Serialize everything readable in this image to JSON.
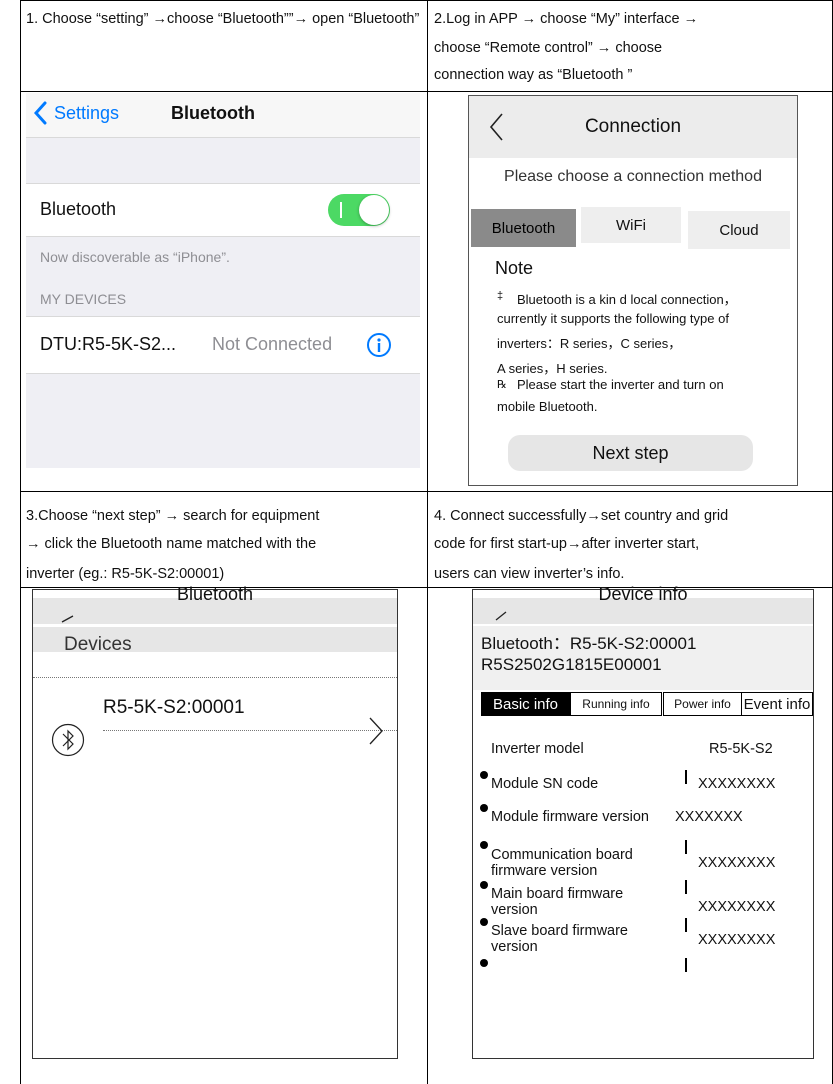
{
  "captions": {
    "step1": "1. Choose “setting” →choose “Bluetooth””→ open “Bluetooth”",
    "step2_line1": "2.Log in APP → choose “My” interface →",
    "step2_line2": "choose “Remote control” → choose",
    "step2_line3": "connection way as “Bluetooth ”",
    "step3_line1": "3.Choose “next step” → search for equipment",
    "step3_line2": "→ click the Bluetooth name matched with the",
    "step3_line3": "inverter (eg.: R5-5K-S2:00001)",
    "step4_line1": "4. Connect successfully→set country and grid",
    "step4_line2": "code for first start-up→after inverter start,",
    "step4_line3": "users can view inverter’s info."
  },
  "ios_settings": {
    "back_label": "Settings",
    "title": "Bluetooth",
    "bluetooth_label": "Bluetooth",
    "toggle_state": "on",
    "discoverable_text": "Now discoverable as “iPhone”.",
    "section_header": "MY DEVICES",
    "device_name": "DTU:R5-5K-S2...",
    "device_status": "Not Connected",
    "accent_color": "#007aff",
    "toggle_color": "#4cd964"
  },
  "connection_screen": {
    "title": "Connection",
    "prompt": "Please choose a connection method",
    "tabs": [
      {
        "label": "Bluetooth",
        "selected": true
      },
      {
        "label": "WiFi",
        "selected": false
      },
      {
        "label": "Cloud",
        "selected": false
      }
    ],
    "note_title": "Note",
    "note_bullet1": "‡",
    "note_line1": "Bluetooth is a kin d local connection，",
    "note_line2": "currently it supports the following type of",
    "note_line3": "inverters：R series，C series，",
    "note_line4": "A series，H series.",
    "note_bullet2": "℞",
    "note_line5": "Please start the inverter and turn on",
    "note_line6": "mobile Bluetooth.",
    "next_button": "Next step"
  },
  "bluetooth_screen": {
    "title": "Bluetooth",
    "section": "Devices",
    "device_name": "R5-5K-S2:00001"
  },
  "device_info": {
    "title": "Device info",
    "bluetooth_line": "Bluetooth：R5-5K-S2:00001",
    "serial_line": "R5S2502G1815E00001",
    "tabs": [
      {
        "label": "Basic info",
        "selected": true
      },
      {
        "label": "Running info",
        "selected": false
      },
      {
        "label": "Power info",
        "selected": false
      },
      {
        "label": "Event info",
        "selected": false
      }
    ],
    "model_label": "Inverter model",
    "model_value": "R5-5K-S2",
    "rows": [
      {
        "label1": "Module SN code",
        "label2": "",
        "value": "XXXXXXXX"
      },
      {
        "label1": "Module firmware version",
        "label2": "",
        "value": "XXXXXXX"
      },
      {
        "label1": "Communication board",
        "label2": "firmware version",
        "value": "XXXXXXXX"
      },
      {
        "label1": "Main board firmware",
        "label2": "version",
        "value": "XXXXXXXX"
      },
      {
        "label1": "Slave board firmware",
        "label2": "version",
        "value": "XXXXXXXX"
      }
    ]
  }
}
